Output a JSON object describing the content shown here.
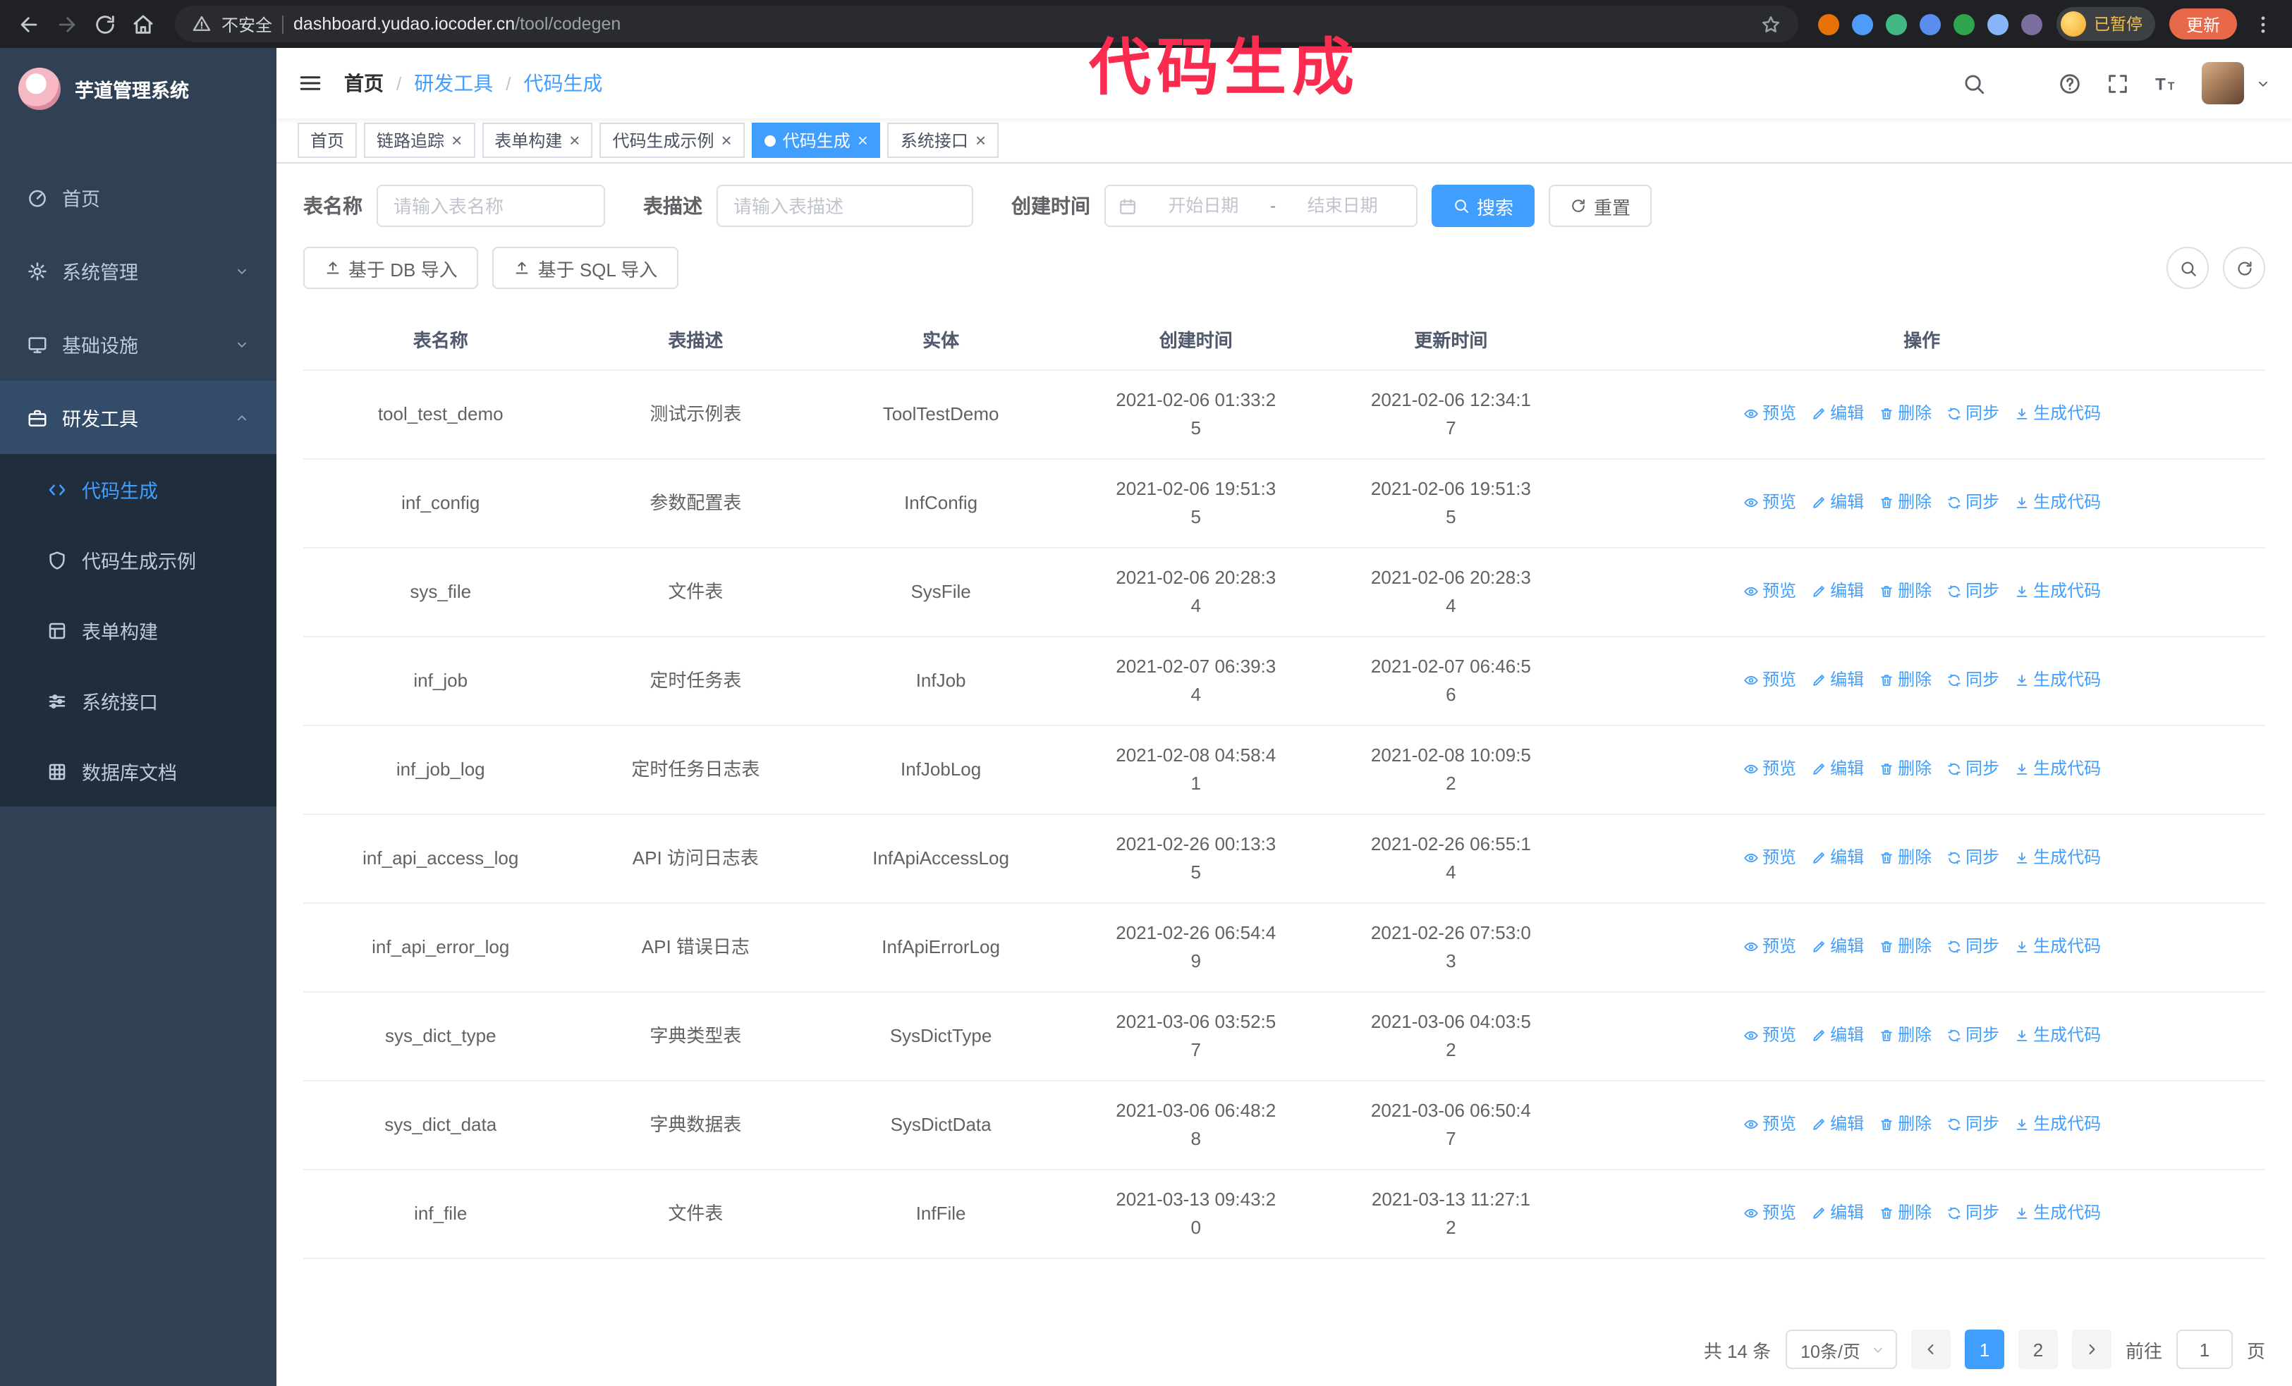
{
  "annotation": {
    "text": "代码生成",
    "color": "#fb2b50"
  },
  "browser": {
    "security_warning": "不安全",
    "url_domain": "dashboard.yudao.iocoder.cn",
    "url_path": "/tool/codegen",
    "paused_badge": "已暂停",
    "update_button": "更新",
    "extension_colors": [
      "#e8710a",
      "#4e9bfa",
      "#41b883",
      "#5b8def",
      "#2ea44f",
      "#8ab4f8",
      "#7c6f9f"
    ]
  },
  "sidebar": {
    "logo_title": "芋道管理系统",
    "items": [
      {
        "name": "home",
        "label": "首页",
        "icon": "dashboard"
      },
      {
        "name": "system",
        "label": "系统管理",
        "icon": "gear",
        "arrow": "down"
      },
      {
        "name": "infrastructure",
        "label": "基础设施",
        "icon": "monitor",
        "arrow": "down"
      },
      {
        "name": "devtools",
        "label": "研发工具",
        "icon": "tools",
        "arrow": "up",
        "expanded": true,
        "children": [
          {
            "name": "codegen",
            "label": "代码生成",
            "icon": "code",
            "active": true
          },
          {
            "name": "codegen-example",
            "label": "代码生成示例",
            "icon": "shield"
          },
          {
            "name": "form-builder",
            "label": "表单构建",
            "icon": "form"
          },
          {
            "name": "system-api",
            "label": "系统接口",
            "icon": "sliders"
          },
          {
            "name": "db-doc",
            "label": "数据库文档",
            "icon": "grid"
          }
        ]
      }
    ]
  },
  "header": {
    "breadcrumb": [
      "首页",
      "研发工具",
      "代码生成"
    ]
  },
  "tabs": [
    {
      "name": "home",
      "label": "首页"
    },
    {
      "name": "tracer",
      "label": "链路追踪",
      "closable": true
    },
    {
      "name": "form-builder",
      "label": "表单构建",
      "closable": true
    },
    {
      "name": "codegen-example",
      "label": "代码生成示例",
      "closable": true
    },
    {
      "name": "codegen",
      "label": "代码生成",
      "closable": true,
      "active": true
    },
    {
      "name": "system-api",
      "label": "系统接口",
      "closable": true
    }
  ],
  "filters": {
    "table_name_label": "表名称",
    "table_name_placeholder": "请输入表名称",
    "table_desc_label": "表描述",
    "table_desc_placeholder": "请输入表描述",
    "create_time_label": "创建时间",
    "start_placeholder": "开始日期",
    "end_placeholder": "结束日期",
    "range_separator": "-",
    "search_button": "搜索",
    "reset_button": "重置"
  },
  "toolbar": {
    "import_db": "基于 DB 导入",
    "import_sql": "基于 SQL 导入"
  },
  "table": {
    "columns": [
      "表名称",
      "表描述",
      "实体",
      "创建时间",
      "更新时间",
      "操作"
    ],
    "actions": [
      {
        "name": "preview",
        "label": "预览",
        "icon": "eye"
      },
      {
        "name": "edit",
        "label": "编辑",
        "icon": "edit"
      },
      {
        "name": "delete",
        "label": "删除",
        "icon": "trash"
      },
      {
        "name": "sync",
        "label": "同步",
        "icon": "sync"
      },
      {
        "name": "generate-code",
        "label": "生成代码",
        "icon": "download"
      }
    ],
    "rows": [
      {
        "name": "tool_test_demo",
        "description": "测试示例表",
        "entity": "ToolTestDemo",
        "create_time": "2021-02-06 01:33:25",
        "update_time": "2021-02-06 12:34:17"
      },
      {
        "name": "inf_config",
        "description": "参数配置表",
        "entity": "InfConfig",
        "create_time": "2021-02-06 19:51:35",
        "update_time": "2021-02-06 19:51:35"
      },
      {
        "name": "sys_file",
        "description": "文件表",
        "entity": "SysFile",
        "create_time": "2021-02-06 20:28:34",
        "update_time": "2021-02-06 20:28:34"
      },
      {
        "name": "inf_job",
        "description": "定时任务表",
        "entity": "InfJob",
        "create_time": "2021-02-07 06:39:34",
        "update_time": "2021-02-07 06:46:56"
      },
      {
        "name": "inf_job_log",
        "description": "定时任务日志表",
        "entity": "InfJobLog",
        "create_time": "2021-02-08 04:58:41",
        "update_time": "2021-02-08 10:09:52"
      },
      {
        "name": "inf_api_access_log",
        "description": "API 访问日志表",
        "entity": "InfApiAccessLog",
        "create_time": "2021-02-26 00:13:35",
        "update_time": "2021-02-26 06:55:14"
      },
      {
        "name": "inf_api_error_log",
        "description": "API 错误日志",
        "entity": "InfApiErrorLog",
        "create_time": "2021-02-26 06:54:49",
        "update_time": "2021-02-26 07:53:03"
      },
      {
        "name": "sys_dict_type",
        "description": "字典类型表",
        "entity": "SysDictType",
        "create_time": "2021-03-06 03:52:57",
        "update_time": "2021-03-06 04:03:52"
      },
      {
        "name": "sys_dict_data",
        "description": "字典数据表",
        "entity": "SysDictData",
        "create_time": "2021-03-06 06:48:28",
        "update_time": "2021-03-06 06:50:47"
      },
      {
        "name": "inf_file",
        "description": "文件表",
        "entity": "InfFile",
        "create_time": "2021-03-13 09:43:20",
        "update_time": "2021-03-13 11:27:12"
      }
    ]
  },
  "pagination": {
    "total_text": "共 14 条",
    "page_size": "10条/页",
    "pages": [
      "1",
      "2"
    ],
    "active_page": "1",
    "goto_prefix": "前往",
    "goto_value": "1",
    "goto_suffix": "页"
  },
  "colors": {
    "accent": "#409eff"
  }
}
